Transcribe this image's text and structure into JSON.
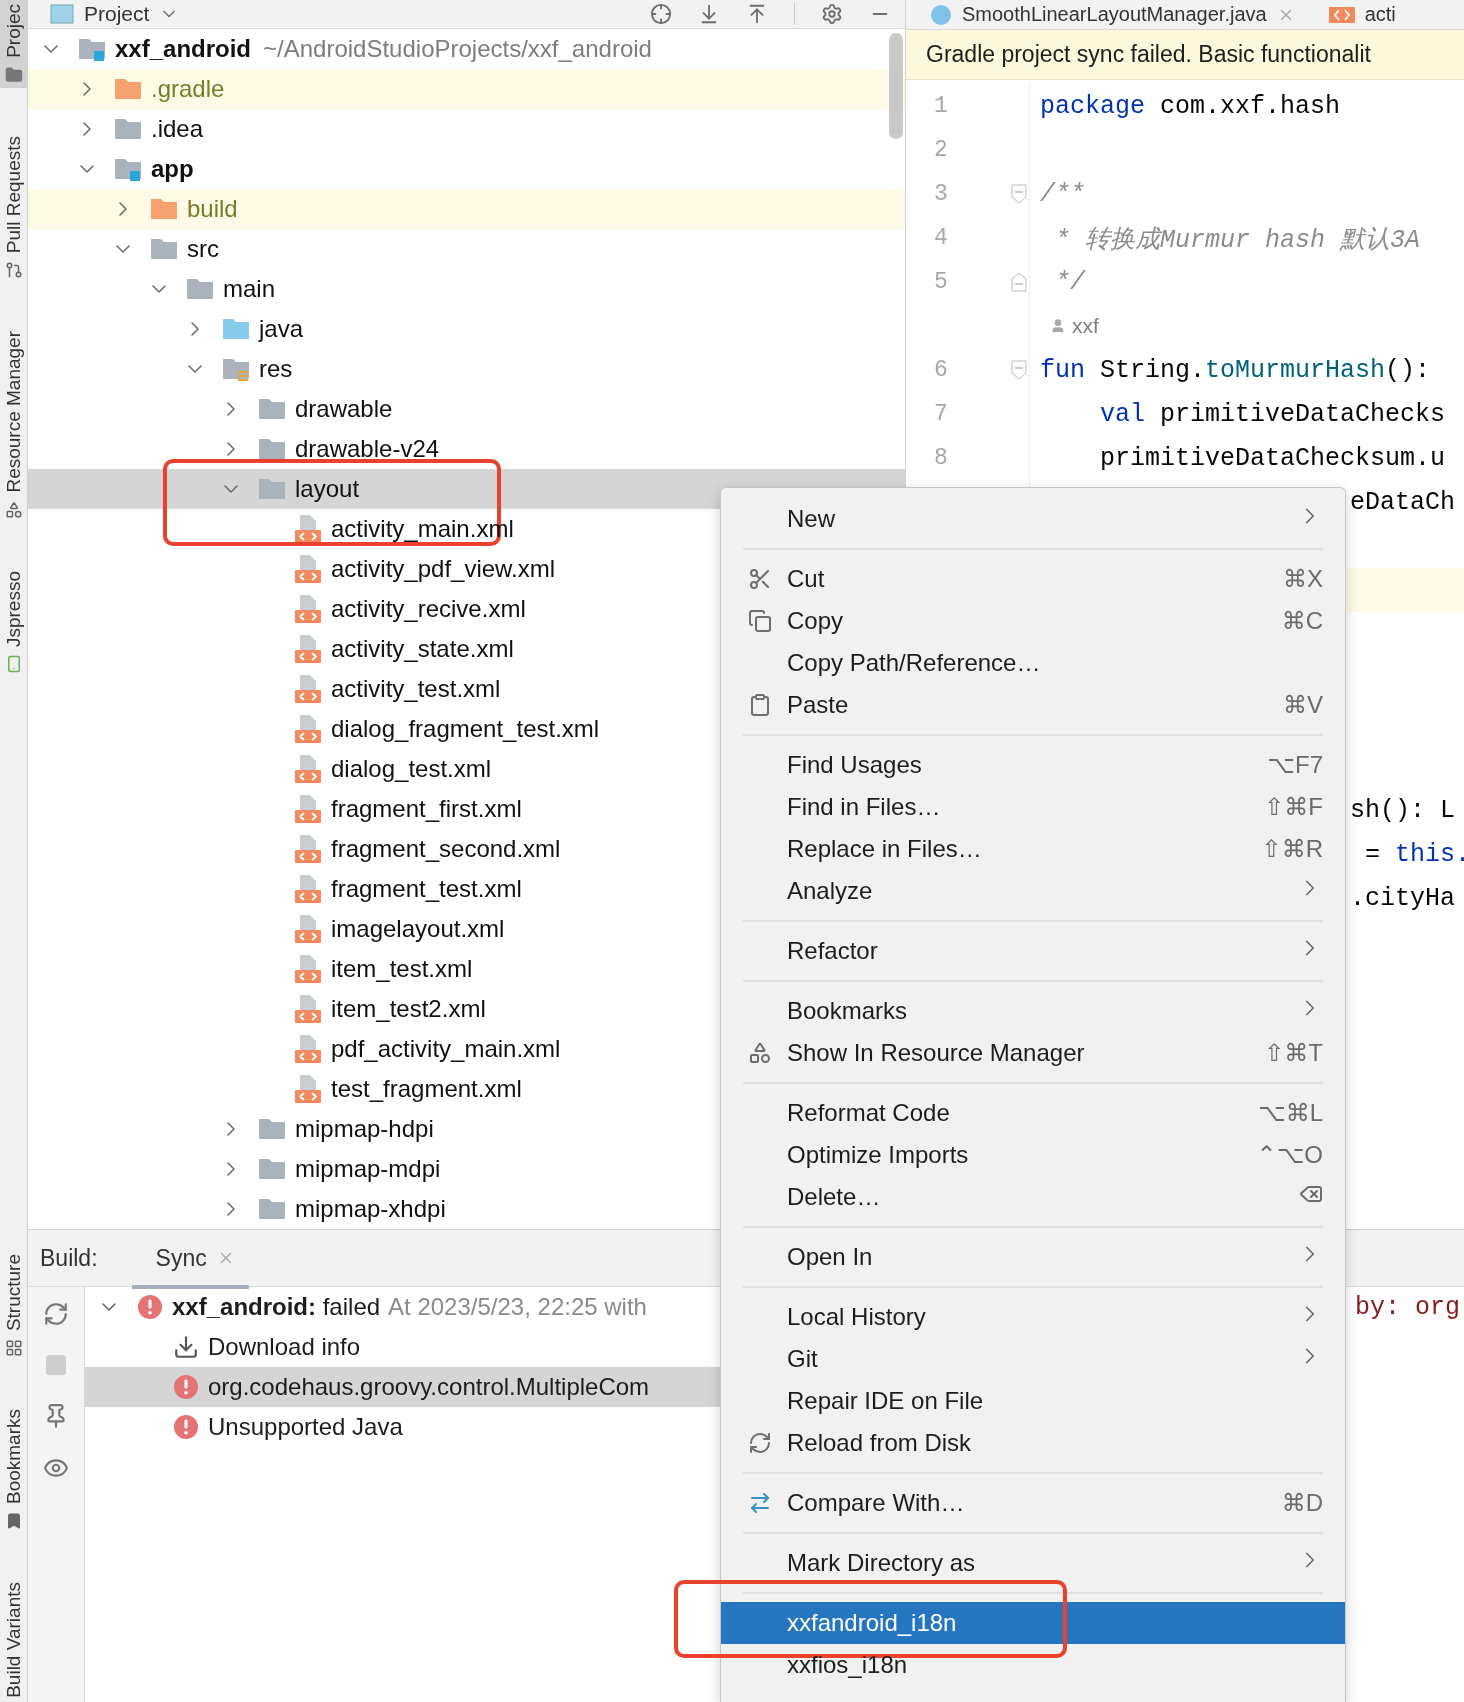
{
  "tool_strip": {
    "top": [
      {
        "label": "Projec",
        "selected": true
      },
      {
        "label": "Pull Requests",
        "selected": false
      },
      {
        "label": "Resource Manager",
        "selected": false
      },
      {
        "label": "Jspresso",
        "selected": false
      }
    ],
    "bottom": [
      {
        "label": "Structure",
        "selected": false
      },
      {
        "label": "Bookmarks",
        "selected": false
      },
      {
        "label": "Build Variants",
        "selected": false
      }
    ]
  },
  "project_panel": {
    "title": "Project",
    "tree": [
      {
        "label": "xxf_android",
        "path": "~/AndroidStudioProjects/xxf_android",
        "kind": "module",
        "expanded": true,
        "selected": false,
        "children": [
          {
            "label": ".gradle",
            "kind": "excluded",
            "expanded": false,
            "selected": false
          },
          {
            "label": ".idea",
            "kind": "folder",
            "expanded": false,
            "selected": false
          },
          {
            "label": "app",
            "kind": "module",
            "expanded": true,
            "selected": false,
            "children": [
              {
                "label": "build",
                "kind": "excluded",
                "expanded": false,
                "selected": false
              },
              {
                "label": "src",
                "kind": "folder",
                "expanded": true,
                "selected": false,
                "children": [
                  {
                    "label": "main",
                    "kind": "folder",
                    "expanded": true,
                    "selected": false,
                    "children": [
                      {
                        "label": "java",
                        "kind": "source",
                        "expanded": false,
                        "selected": false
                      },
                      {
                        "label": "res",
                        "kind": "resources",
                        "expanded": true,
                        "selected": false,
                        "children": [
                          {
                            "label": "drawable",
                            "kind": "folder",
                            "expanded": false,
                            "selected": false
                          },
                          {
                            "label": "drawable-v24",
                            "kind": "folder",
                            "expanded": false,
                            "selected": false
                          },
                          {
                            "label": "layout",
                            "kind": "folder",
                            "expanded": true,
                            "selected": true,
                            "framed": true,
                            "children": [
                              {
                                "label": "activity_main.xml",
                                "kind": "xml",
                                "selected": false
                              },
                              {
                                "label": "activity_pdf_view.xml",
                                "kind": "xml",
                                "selected": false
                              },
                              {
                                "label": "activity_recive.xml",
                                "kind": "xml",
                                "selected": false
                              },
                              {
                                "label": "activity_state.xml",
                                "kind": "xml",
                                "selected": false
                              },
                              {
                                "label": "activity_test.xml",
                                "kind": "xml",
                                "selected": false
                              },
                              {
                                "label": "dialog_fragment_test.xml",
                                "kind": "xml",
                                "selected": false
                              },
                              {
                                "label": "dialog_test.xml",
                                "kind": "xml",
                                "selected": false
                              },
                              {
                                "label": "fragment_first.xml",
                                "kind": "xml",
                                "selected": false
                              },
                              {
                                "label": "fragment_second.xml",
                                "kind": "xml",
                                "selected": false
                              },
                              {
                                "label": "fragment_test.xml",
                                "kind": "xml",
                                "selected": false
                              },
                              {
                                "label": "imagelayout.xml",
                                "kind": "xml",
                                "selected": false
                              },
                              {
                                "label": "item_test.xml",
                                "kind": "xml",
                                "selected": false
                              },
                              {
                                "label": "item_test2.xml",
                                "kind": "xml",
                                "selected": false
                              },
                              {
                                "label": "pdf_activity_main.xml",
                                "kind": "xml",
                                "selected": false
                              },
                              {
                                "label": "test_fragment.xml",
                                "kind": "xml",
                                "selected": false
                              }
                            ]
                          },
                          {
                            "label": "mipmap-hdpi",
                            "kind": "folder",
                            "expanded": false,
                            "selected": false
                          },
                          {
                            "label": "mipmap-mdpi",
                            "kind": "folder",
                            "expanded": false,
                            "selected": false
                          },
                          {
                            "label": "mipmap-xhdpi",
                            "kind": "folder",
                            "expanded": false,
                            "selected": false
                          }
                        ]
                      }
                    ]
                  }
                ]
              }
            ]
          }
        ]
      }
    ]
  },
  "editor": {
    "tabs": [
      {
        "label": "SmoothLinearLayoutManager.java",
        "kind": "java",
        "selected": false
      },
      {
        "label": "acti",
        "kind": "xml",
        "selected": false
      }
    ],
    "banner": "Gradle project sync failed. Basic functionalit",
    "lines": [
      {
        "kind": "code",
        "number": "1",
        "tokens": [
          {
            "text": "package",
            "kind": "keyword"
          },
          {
            "text": " com.xxf.hash",
            "kind": "plain"
          }
        ]
      },
      {
        "kind": "code",
        "number": "2"
      },
      {
        "kind": "code",
        "number": "3",
        "fold_start": true,
        "tokens": [
          {
            "text": "/**",
            "kind": "comment"
          }
        ]
      },
      {
        "kind": "code",
        "number": "4",
        "tokens": [
          {
            "text": " * 转换成Murmur hash 默认3A",
            "kind": "comment"
          }
        ]
      },
      {
        "kind": "code",
        "number": "5",
        "fold_end": true,
        "tokens": [
          {
            "text": " */",
            "kind": "comment"
          }
        ]
      },
      {
        "kind": "author",
        "author": "xxf"
      },
      {
        "kind": "code",
        "number": "6",
        "fold_start": true,
        "tokens": [
          {
            "text": "fun",
            "kind": "keyword"
          },
          {
            "text": " String.",
            "kind": "plain"
          },
          {
            "text": "toMurmurHash",
            "kind": "function"
          },
          {
            "text": "():",
            "kind": "plain"
          }
        ]
      },
      {
        "kind": "code",
        "number": "7",
        "indented": true,
        "tokens": [
          {
            "text": "val",
            "kind": "keyword"
          },
          {
            "text": " primitiveDataChecks",
            "kind": "plain"
          }
        ]
      },
      {
        "kind": "code",
        "number": "8",
        "indented": true,
        "tokens": [
          {
            "text": "primitiveDataChecksum.u",
            "kind": "plain"
          }
        ]
      },
      {
        "kind": "tail",
        "tokens": [
          {
            "text": "eDataCh",
            "kind": "plain"
          }
        ]
      },
      {
        "kind": "tail"
      },
      {
        "kind": "tail",
        "current": true
      },
      {
        "kind": "tail"
      },
      {
        "kind": "tail"
      },
      {
        "kind": "tail"
      },
      {
        "kind": "tail"
      },
      {
        "kind": "tail",
        "tokens": [
          {
            "text": "sh(): L",
            "kind": "plain"
          }
        ]
      },
      {
        "kind": "tail",
        "tokens": [
          {
            "text": " = ",
            "kind": "plain"
          },
          {
            "text": "this.",
            "kind": "keyword"
          }
        ]
      },
      {
        "kind": "tail",
        "tokens": [
          {
            "text": ".cityHa",
            "kind": "plain"
          }
        ]
      }
    ]
  },
  "build_panel": {
    "label": "Build:",
    "tabs": [
      {
        "label": "Sync",
        "selected": true
      }
    ],
    "tree": [
      {
        "title": "**xxf_android:** failed",
        "detail": "At 2023/5/23, 22:25 with",
        "kind": "error",
        "expanded": true,
        "selected": false,
        "children": [
          {
            "text": "Download info",
            "kind": "download",
            "selected": false
          },
          {
            "text": "org.codehaus.groovy.control.MultipleCom",
            "kind": "error",
            "selected": true
          },
          {
            "text": "Unsupported Java",
            "kind": "error",
            "selected": false
          }
        ]
      }
    ],
    "console": [
      "by: org"
    ]
  },
  "context_menu": {
    "groups": [
      [
        {
          "label": "New",
          "submenu": true,
          "selected": false
        }
      ],
      [
        {
          "label": "Cut",
          "shortcut": "⌘X",
          "submenu": false,
          "selected": false
        },
        {
          "label": "Copy",
          "shortcut": "⌘C",
          "submenu": false,
          "selected": false
        },
        {
          "label": "Copy Path/Reference…",
          "submenu": false,
          "selected": false
        },
        {
          "label": "Paste",
          "shortcut": "⌘V",
          "submenu": false,
          "selected": false
        }
      ],
      [
        {
          "label": "Find Usages",
          "shortcut": "⌥F7",
          "submenu": false,
          "selected": false
        },
        {
          "label": "Find in Files…",
          "shortcut": "⇧⌘F",
          "submenu": false,
          "selected": false
        },
        {
          "label": "Replace in Files…",
          "shortcut": "⇧⌘R",
          "submenu": false,
          "selected": false
        },
        {
          "label": "Analyze",
          "submenu": true,
          "selected": false
        }
      ],
      [
        {
          "label": "Refactor",
          "submenu": true,
          "selected": false
        }
      ],
      [
        {
          "label": "Bookmarks",
          "submenu": true,
          "selected": false
        },
        {
          "label": "Show In Resource Manager",
          "shortcut": "⇧⌘T",
          "submenu": false,
          "selected": false
        }
      ],
      [
        {
          "label": "Reformat Code",
          "shortcut": "⌥⌘L",
          "submenu": false,
          "selected": false
        },
        {
          "label": "Optimize Imports",
          "shortcut": "⌃⌥O",
          "submenu": false,
          "selected": false
        },
        {
          "label": "Delete…",
          "submenu": false,
          "selected": false
        }
      ],
      [
        {
          "label": "Open In",
          "submenu": true,
          "selected": false
        }
      ],
      [
        {
          "label": "Local History",
          "submenu": true,
          "selected": false
        },
        {
          "label": "Git",
          "submenu": true,
          "selected": false
        },
        {
          "label": "Repair IDE on File",
          "submenu": false,
          "selected": false
        },
        {
          "label": "Reload from Disk",
          "submenu": false,
          "selected": false
        }
      ],
      [
        {
          "label": "Compare With…",
          "shortcut": "⌘D",
          "submenu": false,
          "selected": false
        }
      ],
      [
        {
          "label": "Mark Directory as",
          "submenu": true,
          "selected": false
        }
      ],
      [
        {
          "label": "xxfandroid_i18n",
          "submenu": false,
          "selected": true,
          "framed": true
        },
        {
          "label": "xxfios_i18n",
          "submenu": false,
          "selected": false
        }
      ]
    ]
  }
}
